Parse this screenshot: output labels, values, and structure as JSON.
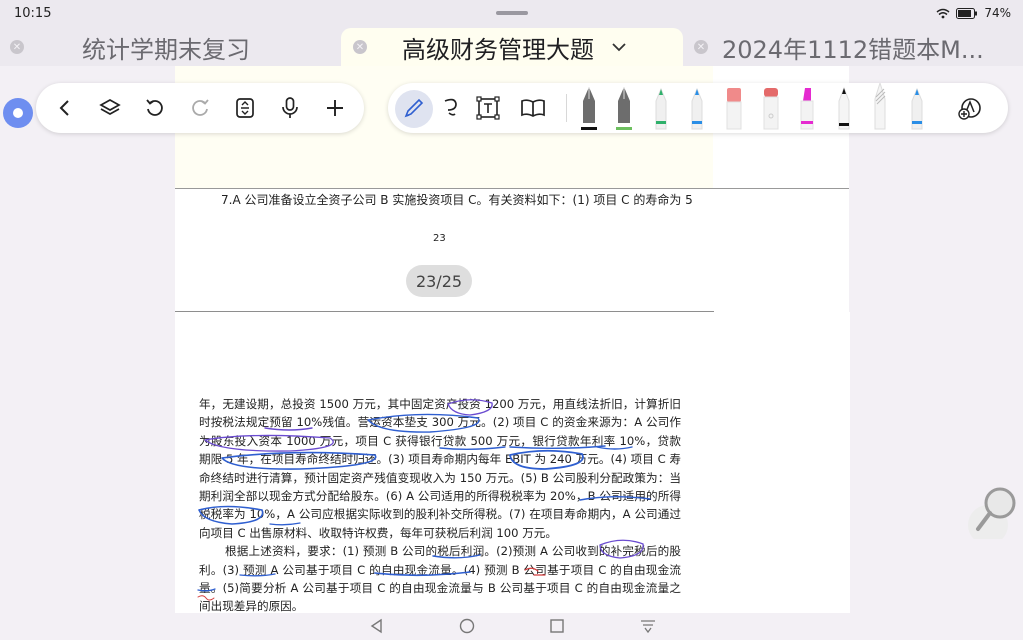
{
  "status_bar": {
    "time": "10:15",
    "battery": "74%"
  },
  "tabs": [
    {
      "label": "统计学期末复习",
      "active": false
    },
    {
      "label": "高级财务管理大题",
      "active": true
    },
    {
      "label": "2024年1112错题本M...",
      "active": false
    }
  ],
  "left_toolbar": {
    "icons": [
      "back-icon",
      "layers-icon",
      "undo-icon",
      "redo-icon",
      "page-scroll-icon",
      "microphone-icon",
      "add-icon"
    ]
  },
  "right_toolbar": {
    "icons": [
      "pen-tool-icon",
      "lasso-icon",
      "text-box-icon",
      "reading-mode-icon"
    ],
    "pens": [
      {
        "name": "fountain-pen-black",
        "color": "#111111"
      },
      {
        "name": "fountain-pen-green",
        "color": "#6dbf5f"
      },
      {
        "name": "ballpoint-green",
        "color": "#2fb06b"
      },
      {
        "name": "ballpoint-blue",
        "color": "#2a8ee6"
      },
      {
        "name": "highlighter-pink",
        "color": "#f08a8a"
      },
      {
        "name": "eraser",
        "color": "#e46a6a"
      },
      {
        "name": "marker-magenta",
        "color": "#e52ad0"
      },
      {
        "name": "pencil-black",
        "color": "#111111"
      },
      {
        "name": "pencil-grey",
        "color": "#bdbdbd"
      },
      {
        "name": "ballpoint-blue-2",
        "color": "#2a8ee6"
      }
    ],
    "extra_icon": "add-pen-icon"
  },
  "document": {
    "page_a_line": "7.A 公司准备设立全资子公司 B 实施投资项目 C。有关资料如下：(1) 项目 C 的寿命为 5",
    "page_a_number": "23",
    "page_indicator": "23/25",
    "page_b_paragraph_1": "年，无建设期，总投资 1500 万元，其中固定资产投资 1200 万元，用直线法折旧，计算折旧时按税法规定预留 10%残值。营运资本垫支 300 万元。(2) 项目 C 的资金来源为：A 公司作为股东投入资本 1000 万元，项目 C 获得银行贷款 500 万元，银行贷款年利率 10%，贷款期限 5 年，在项目寿命终结时归还。(3) 项目寿命期内每年 EBIT 为 240 万元。(4) 项目 C 寿命终结时进行清算，预计固定资产残值变现收入为 150 万元。(5) B 公司股利分配政策为：当期利润全部以现金方式分配给股东。(6) A 公司适用的所得税税率为 20%，B 公司适用的所得税税率为 10%，A 公司应根据实际收到的股利补交所得税。(7) 在项目寿命期内，A 公司通过向项目 C 出售原材料、收取特许权费，每年可获税后利润 100 万元。",
    "page_b_paragraph_2": "根据上述资料，要求：(1) 预测 B 公司的税后利润。(2)预测 A 公司收到的补完税后的股利。(3) 预测 A 公司基于项目 C 的自由现金流量。(4) 预测 B 公司基于项目 C 的自由现金流量。(5)简要分析 A 公司基于项目 C 的自由现金流量与 B 公司基于项目 C 的自由现金流量之间出现差异的原因。"
  },
  "colors": {
    "accent": "#6e8ef0",
    "ink_blue": "#2f5fd0",
    "ink_purple": "#6a4bd0",
    "ink_red": "#d23a3a"
  }
}
